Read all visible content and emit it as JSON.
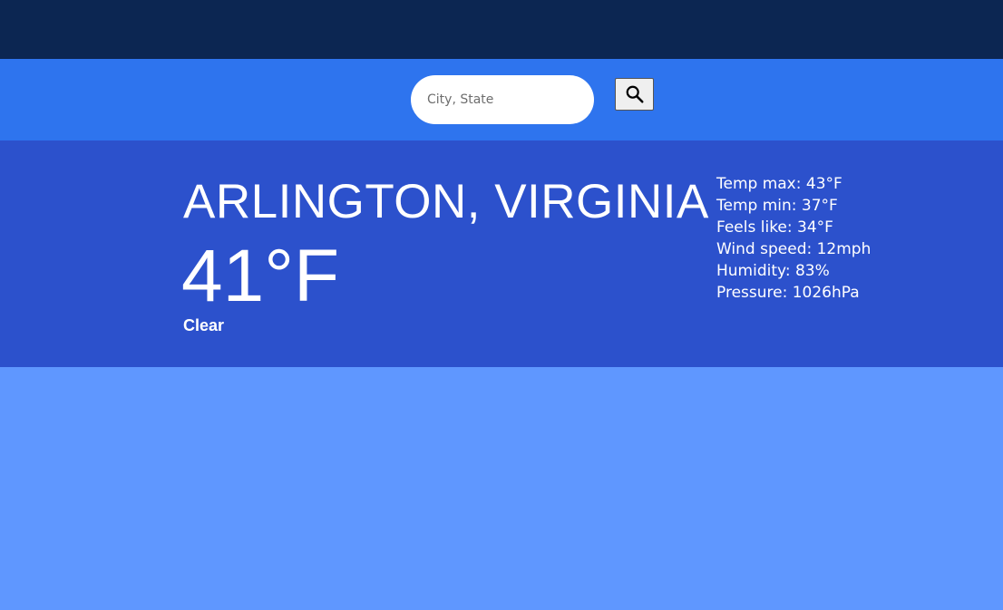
{
  "search": {
    "placeholder": "City, State",
    "value": "",
    "button_icon": "search-icon"
  },
  "weather": {
    "location": "ARLINGTON, VIRGINIA",
    "temperature": "41°F",
    "condition": "Clear",
    "details": [
      "Temp max: 43°F",
      "Temp min: 37°F",
      "Feels like: 34°F",
      "Wind speed: 12mph",
      "Humidity: 83%",
      "Pressure: 1026hPa"
    ]
  },
  "colors": {
    "topbar": "#0c2652",
    "searchbar": "#2e74ee",
    "weather_panel": "#2c51cc",
    "background": "#5f97ff",
    "text": "#ffffff"
  }
}
